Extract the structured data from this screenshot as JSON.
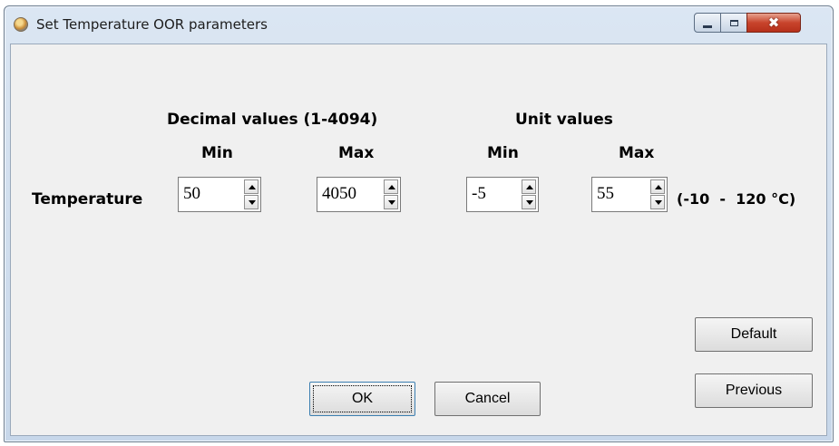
{
  "window": {
    "title": "Set Temperature OOR parameters",
    "icon": "app-globe-icon",
    "controls": {
      "minimize": "minimize-icon",
      "maximize": "maximize-icon",
      "close": "✖"
    }
  },
  "headers": {
    "decimal": "Decimal values (1-4094)",
    "unit": "Unit values",
    "min": "Min",
    "max": "Max"
  },
  "row": {
    "label": "Temperature",
    "decimal_min": "50",
    "decimal_max": "4050",
    "unit_min": "-5",
    "unit_max": "55",
    "range_hint": "(-10  -  120 °C)"
  },
  "buttons": {
    "default": "Default",
    "previous": "Previous",
    "ok": "OK",
    "cancel": "Cancel"
  },
  "colors": {
    "client_bg": "#f0f0f0",
    "close_button": "#c8442c",
    "focus_border": "#3c7fb1"
  }
}
